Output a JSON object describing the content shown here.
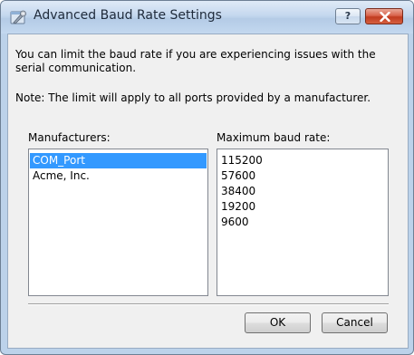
{
  "window": {
    "title": "Advanced Baud Rate Settings",
    "help_label": "?"
  },
  "content": {
    "description": "You can limit the baud rate if you are experiencing issues with the",
    "description_line2": "serial communication.",
    "note": "Note: The limit will apply to all ports provided by a manufacturer."
  },
  "manufacturers": {
    "label": "Manufacturers:",
    "items": [
      "COM_Port",
      "Acme, Inc."
    ],
    "selected": "COM_Port"
  },
  "baud": {
    "label": "Maximum baud rate:",
    "items": [
      "115200",
      "57600",
      "38400",
      "19200",
      "9600"
    ]
  },
  "buttons": {
    "ok": "OK",
    "cancel": "Cancel"
  },
  "colors": {
    "selection": "#3399ff",
    "close_button": "#c03a1f"
  },
  "icons": {
    "title": "settings-tools-icon",
    "close": "close-icon"
  }
}
